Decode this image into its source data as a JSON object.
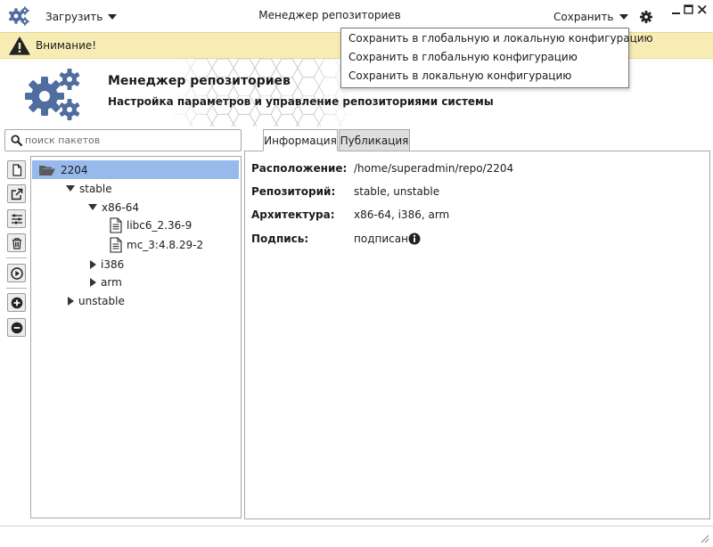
{
  "titlebar": {
    "load_label": "Загрузить",
    "title": "Менеджер репозиториев",
    "save_label": "Сохранить"
  },
  "warning": {
    "text": "Внимание!"
  },
  "header": {
    "title": "Менеджер репозиториев",
    "subtitle": "Настройка параметров и управление репозиториями системы"
  },
  "search": {
    "placeholder": "поиск пакетов",
    "value": ""
  },
  "toolbar_icons": [
    "new-file-icon",
    "open-external-icon",
    "sliders-icon",
    "trash-icon",
    "play-icon",
    "plus-circle-icon",
    "minus-circle-icon"
  ],
  "tree": {
    "root": "2204",
    "stable": "stable",
    "x86": "x86-64",
    "pkg1": "libc6_2.36-9",
    "pkg2": "mc_3:4.8.29-2",
    "i386": "i386",
    "arm": "arm",
    "unstable": "unstable"
  },
  "tabs": {
    "info": "Информация",
    "publish": "Публикация"
  },
  "info": {
    "location_label": "Расположение:",
    "location_value": "/home/superadmin/repo/2204",
    "repo_label": "Репозиторий:",
    "repo_value": "stable, unstable",
    "arch_label": "Архитектура:",
    "arch_value": "x86-64, i386, arm",
    "sign_label": "Подпись:",
    "sign_value": "подписан"
  },
  "save_menu": {
    "items": [
      "Сохранить в глобальную и локальную конфигурацию",
      "Сохранить в глобальную конфигурацию",
      "Сохранить в локальную конфигурацию"
    ]
  },
  "colors": {
    "logo_blue": "#4f6d9e",
    "warning_bg": "#f7ecb4",
    "tree_selection": "#97b9ec",
    "folder_grey": "#5a5a5a"
  }
}
